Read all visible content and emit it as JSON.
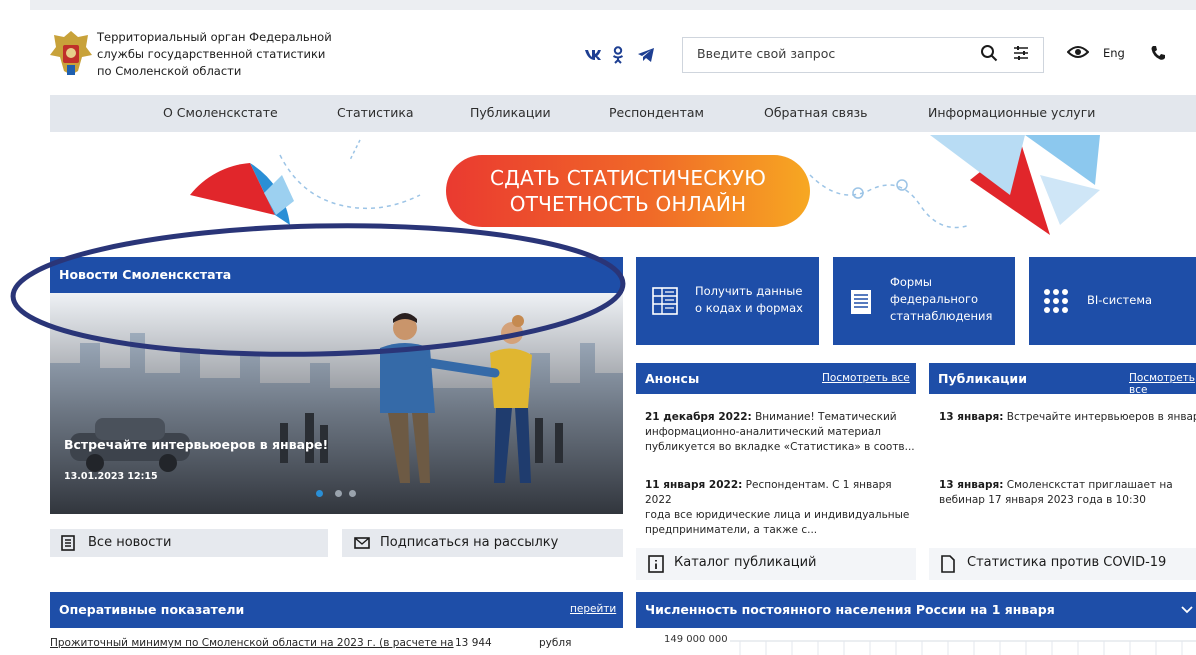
{
  "header": {
    "org_line1": "Территориальный орган Федеральной",
    "org_line2": "службы государственной статистики",
    "org_line3": "по Смоленской области",
    "search_placeholder": "Введите свой запрос",
    "lang": "Eng",
    "icons": [
      "vk-icon",
      "ok-icon",
      "telegram-icon",
      "search-icon",
      "filter-icon",
      "eye-icon",
      "phone-icon"
    ]
  },
  "nav": {
    "items": [
      "О Смоленскстате",
      "Статистика",
      "Публикации",
      "Респондентам",
      "Обратная связь",
      "Информационные услуги"
    ]
  },
  "banner": {
    "line1": "СДАТЬ СТАТИСТИЧЕСКУЮ",
    "line2": "ОТЧЕТНОСТЬ ОНЛАЙН"
  },
  "news": {
    "title": "Новости Смоленскстата",
    "slide_title": "Встречайте интервьюеров в январе!",
    "slide_date": "13.01.2023 12:15",
    "all_news": "Все новости",
    "subscribe": "Подписаться на рассылку"
  },
  "tiles": [
    {
      "line1": "Получить данные",
      "line2": "о кодах и формах"
    },
    {
      "line1": "Формы",
      "line2": "федерального",
      "line3": "статнаблюдения"
    },
    {
      "line1": "BI-система"
    }
  ],
  "announcements": {
    "title": "Анонсы",
    "more": "Посмотреть все",
    "items": [
      {
        "date": "21 декабря 2022:",
        "l1": " Внимание! Тематический",
        "l2": "информационно-аналитический материал",
        "l3": "публикуется во вкладке «Статистика» в соотв..."
      },
      {
        "date": "11 января 2022:",
        "l1": " Респондентам. С 1 января 2022",
        "l2": "года все юридические лица и индивидуальные",
        "l3": "предприниматели, а также с..."
      }
    ],
    "catalog": "Каталог публикаций"
  },
  "publications": {
    "title": "Публикации",
    "more": "Посмотреть все",
    "items": [
      {
        "date": "13 января:",
        "l1": " Встречайте интервьюеров в январе!"
      },
      {
        "date": "13 января:",
        "l1": " Смоленскстат приглашает на",
        "l2": "вебинар 17 января 2023 года в 10:30"
      }
    ],
    "covid": "Статистика против COVID-19"
  },
  "indicators": {
    "title": "Оперативные показатели",
    "more": "перейти",
    "row_label": "Прожиточный минимум по Смоленской области на 2023 г. (в расчете на",
    "row_value": "13 944",
    "row_unit": "рубля"
  },
  "population": {
    "title": "Численность постоянного населения России на 1 января",
    "axis_top": "149 000 000"
  },
  "colors": {
    "brand_blue": "#1e4ea8",
    "nav_bg": "#e3e7ed",
    "banner_orange": "#f06828",
    "annotation_ellipse": "#2a3578"
  }
}
